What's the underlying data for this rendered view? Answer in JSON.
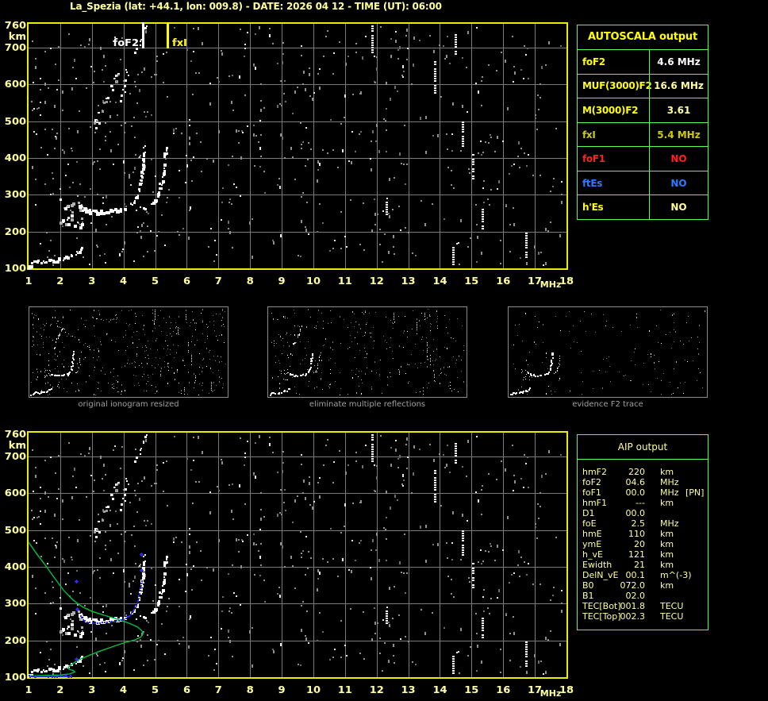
{
  "title": "La_Spezia (lat: +44.1, lon: 009.8) - DATE: 2026 04 12 - TIME (UT): 06:00",
  "colors": {
    "background": "#000000",
    "title_text": "#FFFF9E",
    "axis_text": "#FFFF9E",
    "plot_border": "#EDED00",
    "grid": "#7A7A7A",
    "echo_white": "#FFFFFF",
    "speckle_gray": "#909090",
    "table_border": "#55FF55",
    "header_yellow": "#FFFF00",
    "pale_yellow": "#FFFF9E",
    "gold": "#CDCD00",
    "red": "#FF2020",
    "blue": "#2E7CFF",
    "caption_gray": "#A0A0A0",
    "profile_green": "#00C040",
    "restored_blue": "#2A2AFF"
  },
  "autoscala": {
    "header": "AUTOSCALA output",
    "rows": [
      {
        "label": "foF2",
        "value": "4.6 MHz",
        "label_color": "#FFFF00",
        "value_color": "#FFFFFF"
      },
      {
        "label": "MUF(3000)F2",
        "value": "16.6 MHz",
        "label_color": "#FFFF00",
        "value_color": "#FFFF9E"
      },
      {
        "label": "M(3000)F2",
        "value": "3.61",
        "label_color": "#FFFF00",
        "value_color": "#FFFF9E"
      },
      {
        "label": "fxI",
        "value": "5.4 MHz",
        "label_color": "#CDCD00",
        "value_color": "#CDCD00"
      },
      {
        "label": "foF1",
        "value": "NO",
        "label_color": "#FF2020",
        "value_color": "#FF2020"
      },
      {
        "label": "ftEs",
        "value": "NO",
        "label_color": "#2E7CFF",
        "value_color": "#2E7CFF"
      },
      {
        "label": "h'Es",
        "value": "NO",
        "label_color": "#FFFF00",
        "value_color": "#FFFF9E"
      }
    ]
  },
  "thumbnails": [
    {
      "caption": "original ionogram resized"
    },
    {
      "caption": "eliminate multiple reflections"
    },
    {
      "caption": "evidence F2 trace"
    }
  ],
  "aip": {
    "header": "AIP output",
    "rows": [
      {
        "param": "hmF2",
        "value": "220",
        "unit": "km",
        "note": ""
      },
      {
        "param": "foF2",
        "value": "04.6",
        "unit": "MHz",
        "note": ""
      },
      {
        "param": "foF1",
        "value": "00.0",
        "unit": "MHz",
        "note": "[PN]"
      },
      {
        "param": "hmF1",
        "value": "---",
        "unit": "km",
        "note": ""
      },
      {
        "param": "D1",
        "value": "00.0",
        "unit": "",
        "note": ""
      },
      {
        "param": "foE",
        "value": "2.5",
        "unit": "MHz",
        "note": ""
      },
      {
        "param": "hmE",
        "value": "110",
        "unit": "km",
        "note": ""
      },
      {
        "param": "ymE",
        "value": "20",
        "unit": "km",
        "note": ""
      },
      {
        "param": "h_vE",
        "value": "121",
        "unit": "km",
        "note": ""
      },
      {
        "param": "Ewidth",
        "value": "21",
        "unit": "km",
        "note": ""
      },
      {
        "param": "DelN_vE",
        "value": "00.1",
        "unit": "m^(-3)",
        "note": ""
      },
      {
        "param": "B0",
        "value": "072.0",
        "unit": "km",
        "note": ""
      },
      {
        "param": "B1",
        "value": "02.0",
        "unit": "",
        "note": ""
      },
      {
        "param": "TEC[Bot]",
        "value": "001.8",
        "unit": "TECU",
        "note": ""
      },
      {
        "param": "TEC[Top]",
        "value": "002.3",
        "unit": "TECU",
        "note": ""
      }
    ]
  },
  "chart_data": [
    {
      "type": "scatter",
      "name": "ionogram_autoscala",
      "xlabel": "MHz",
      "ylabel": "km",
      "xlim": [
        1,
        18
      ],
      "ylim": [
        100,
        760
      ],
      "x_ticks": [
        1,
        2,
        3,
        4,
        5,
        6,
        7,
        8,
        9,
        10,
        11,
        12,
        13,
        14,
        15,
        16,
        17,
        18
      ],
      "y_ticks": [
        100,
        200,
        300,
        400,
        500,
        600,
        700,
        760
      ],
      "grid": true,
      "annotations": [
        {
          "label": "foF2",
          "f": 4.6,
          "color": "#FFFFFF"
        },
        {
          "label": "fxI",
          "f": 5.4,
          "color": "#FFFF00"
        }
      ],
      "traces": {
        "E_layer": [
          [
            1.02,
            103
          ],
          [
            1.2,
            116
          ],
          [
            1.5,
            118
          ],
          [
            1.8,
            119
          ],
          [
            2.0,
            122
          ],
          [
            2.2,
            127
          ],
          [
            2.4,
            134
          ],
          [
            2.55,
            143
          ],
          [
            2.7,
            153
          ]
        ],
        "F_leading_cluster": {
          "f": [
            1.95,
            2.7
          ],
          "h": [
            215,
            300
          ],
          "n": 26
        },
        "F_flat": [
          [
            2.6,
            268
          ],
          [
            2.8,
            258
          ],
          [
            3.0,
            253
          ],
          [
            3.3,
            252
          ],
          [
            3.6,
            255
          ],
          [
            3.9,
            258
          ],
          [
            4.1,
            262
          ]
        ],
        "F_riser": [
          [
            4.1,
            262
          ],
          [
            4.3,
            276
          ],
          [
            4.45,
            296
          ],
          [
            4.55,
            330
          ],
          [
            4.62,
            372
          ],
          [
            4.66,
            410
          ],
          [
            4.68,
            432
          ]
        ],
        "X_flat": [
          [
            4.45,
            262
          ],
          [
            4.7,
            264
          ],
          [
            4.85,
            268
          ]
        ],
        "X_riser": [
          [
            4.85,
            268
          ],
          [
            5.0,
            281
          ],
          [
            5.12,
            302
          ],
          [
            5.22,
            337
          ],
          [
            5.3,
            377
          ],
          [
            5.34,
            412
          ],
          [
            5.36,
            430
          ]
        ],
        "second_hop_band": {
          "from": [
            3.0,
            478
          ],
          "to": [
            3.85,
            640
          ],
          "n": 24,
          "jitter_km": 38
        },
        "second_hop_riser": [
          [
            3.95,
            560
          ],
          [
            4.05,
            600
          ],
          [
            4.12,
            648
          ]
        ],
        "top_multiple": [
          [
            4.35,
            680
          ],
          [
            4.5,
            705
          ],
          [
            4.6,
            735
          ],
          [
            4.68,
            756
          ]
        ],
        "rfi_streaks": [
          {
            "f": 11.85,
            "h": [
              688,
              760
            ]
          },
          {
            "f": 13.85,
            "h": [
              578,
              662
            ]
          },
          {
            "f": 14.5,
            "h": [
              680,
              736
            ]
          },
          {
            "f": 14.72,
            "h": [
              430,
              506
            ]
          },
          {
            "f": 15.05,
            "h": [
              335,
              410
            ]
          },
          {
            "f": 15.35,
            "h": [
              210,
              262
            ]
          },
          {
            "f": 16.72,
            "h": [
              130,
              196
            ]
          },
          {
            "f": 14.42,
            "h": [
              108,
              158
            ]
          },
          {
            "f": 12.3,
            "h": [
              246,
              282
            ]
          }
        ]
      }
    },
    {
      "type": "scatter",
      "name": "ionogram_aip_profile",
      "xlabel": "MHz",
      "ylabel": "km",
      "xlim": [
        1,
        18
      ],
      "ylim": [
        100,
        760
      ],
      "x_ticks": [
        1,
        2,
        3,
        4,
        5,
        6,
        7,
        8,
        9,
        10,
        11,
        12,
        13,
        14,
        15,
        16,
        17,
        18
      ],
      "y_ticks": [
        100,
        200,
        300,
        400,
        500,
        600,
        700,
        760
      ],
      "grid": true,
      "note": "same echo traces as ionogram_autoscala",
      "profile_green": [
        [
          1.0,
          467
        ],
        [
          1.25,
          436
        ],
        [
          1.5,
          408
        ],
        [
          1.8,
          372
        ],
        [
          2.1,
          337
        ],
        [
          2.4,
          310
        ],
        [
          2.7,
          291
        ],
        [
          3.0,
          279
        ],
        [
          3.4,
          268
        ],
        [
          3.8,
          258
        ],
        [
          4.2,
          246
        ],
        [
          4.45,
          236
        ],
        [
          4.58,
          226
        ],
        [
          4.62,
          218
        ],
        [
          4.55,
          209
        ],
        [
          4.35,
          201
        ],
        [
          4.0,
          193
        ],
        [
          3.6,
          181
        ],
        [
          3.2,
          169
        ],
        [
          2.85,
          157
        ],
        [
          2.6,
          148
        ],
        [
          2.4,
          137
        ],
        [
          2.25,
          127
        ],
        [
          2.28,
          121
        ],
        [
          2.42,
          118
        ],
        [
          2.46,
          114
        ],
        [
          2.3,
          109
        ],
        [
          2.0,
          106
        ],
        [
          1.6,
          105
        ],
        [
          1.2,
          104
        ],
        [
          1.0,
          104
        ]
      ],
      "restored_trace_blue": {
        "E_flat": {
          "f": [
            1.0,
            2.35
          ],
          "h": 104
        },
        "F_trace": [
          [
            2.62,
            268
          ],
          [
            2.7,
            258
          ],
          [
            2.82,
            252
          ],
          [
            3.0,
            249
          ],
          [
            3.3,
            250
          ],
          [
            3.6,
            253
          ],
          [
            3.9,
            257
          ],
          [
            4.05,
            262
          ],
          [
            4.2,
            272
          ],
          [
            4.35,
            291
          ],
          [
            4.45,
            316
          ],
          [
            4.52,
            343
          ],
          [
            4.56,
            363
          ]
        ],
        "points": [
          [
            2.5,
            150
          ],
          [
            2.5,
            360
          ],
          [
            2.52,
            285
          ],
          [
            4.55,
            392
          ],
          [
            4.57,
            435
          ]
        ]
      }
    }
  ]
}
